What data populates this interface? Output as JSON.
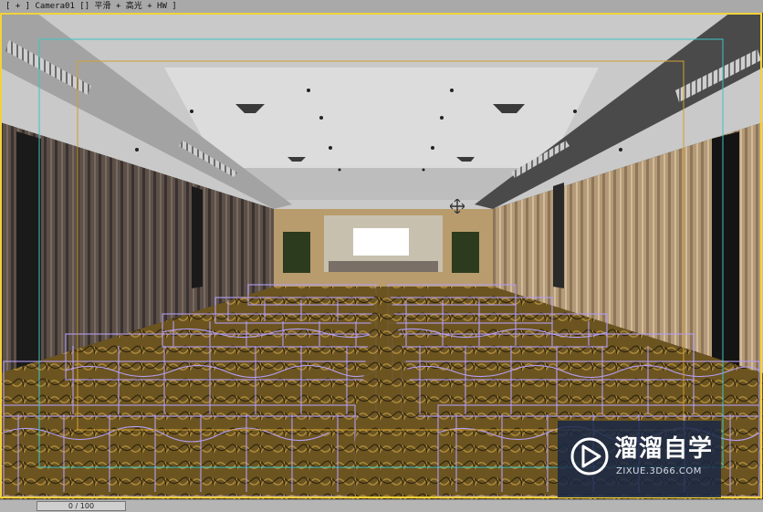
{
  "viewport": {
    "label": "[ + ] Camera01 [] 平滑 + 高光 + HW ]",
    "border_color": "#f2d23a",
    "safe_frame_color": "#3fc4c4",
    "render_frame_color": "#d0a030",
    "wireframe_color": "#b49ef2"
  },
  "scene": {
    "screen_color": "#ffffff",
    "curtain_left_color": "#5c5048",
    "curtain_right_color": "#b49a78",
    "carpet_color": "#6b5420"
  },
  "nav_gizmo": {
    "icon": "move-cross-icon"
  },
  "status": {
    "frame_counter": "0 / 100"
  },
  "watermark": {
    "title": "溜溜自学",
    "url": "ZIXUE.3D66.COM",
    "icon": "play-logo-icon",
    "bg_color": "#1c2a48"
  }
}
